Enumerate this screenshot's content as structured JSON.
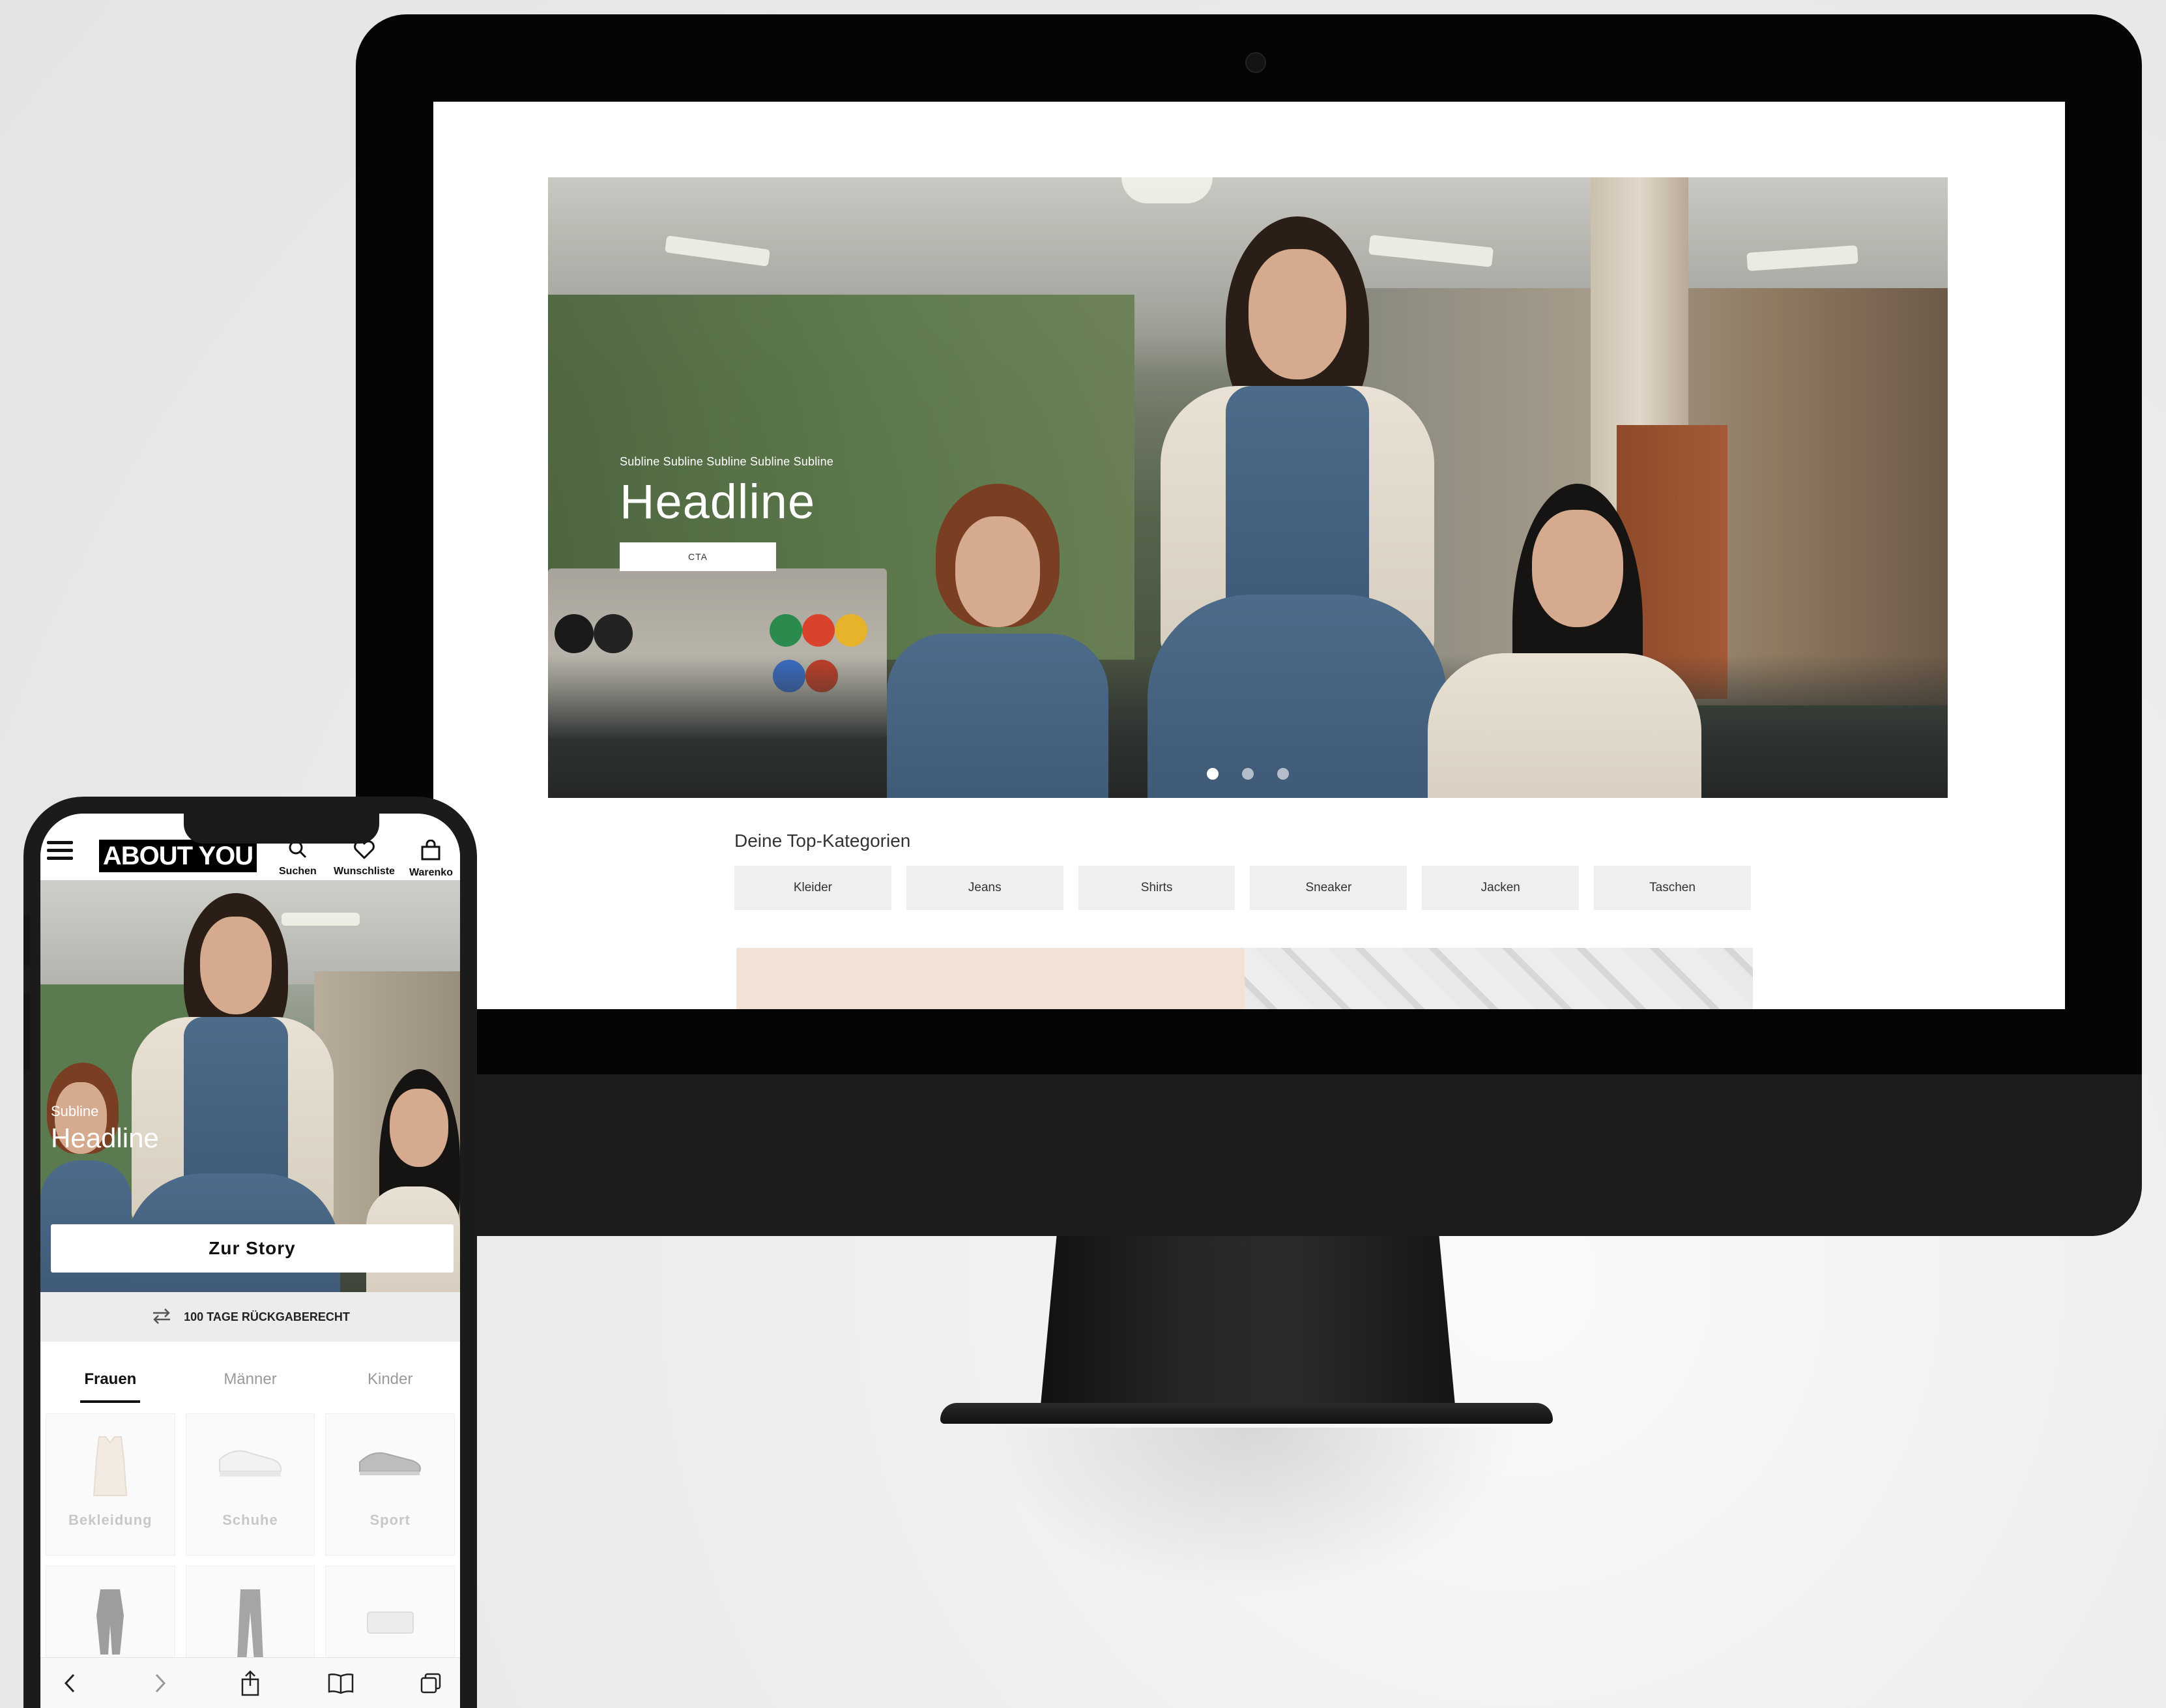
{
  "desktop": {
    "hero": {
      "subline": "Subline Subline Subline Subline Subline",
      "headline": "Headline",
      "cta_label": "CTA",
      "slide_count": 3,
      "active_slide": 1
    },
    "top_categories": {
      "title": "Deine Top-Kategorien",
      "items": [
        "Kleider",
        "Jeans",
        "Shirts",
        "Sneaker",
        "Jacken",
        "Taschen"
      ]
    }
  },
  "mobile": {
    "logo_text": "ABOUT YOU",
    "header_actions": {
      "search_label": "Suchen",
      "wishlist_label": "Wunschliste",
      "cart_label": "Warenko"
    },
    "hero": {
      "subline": "Subline",
      "headline": "Headline",
      "cta_label": "Zur Story"
    },
    "returns_banner": "100 TAGE RÜCKGABERECHT",
    "tabs": [
      {
        "label": "Frauen",
        "active": true
      },
      {
        "label": "Männer",
        "active": false
      },
      {
        "label": "Kinder",
        "active": false
      }
    ],
    "category_tiles": [
      "Bekleidung",
      "Schuhe",
      "Sport",
      "",
      "",
      ""
    ]
  },
  "colors": {
    "accent_black": "#111111",
    "chip_bg": "#efefef",
    "returns_bg": "#ececec",
    "teaser_peach": "#f1e2d5"
  }
}
